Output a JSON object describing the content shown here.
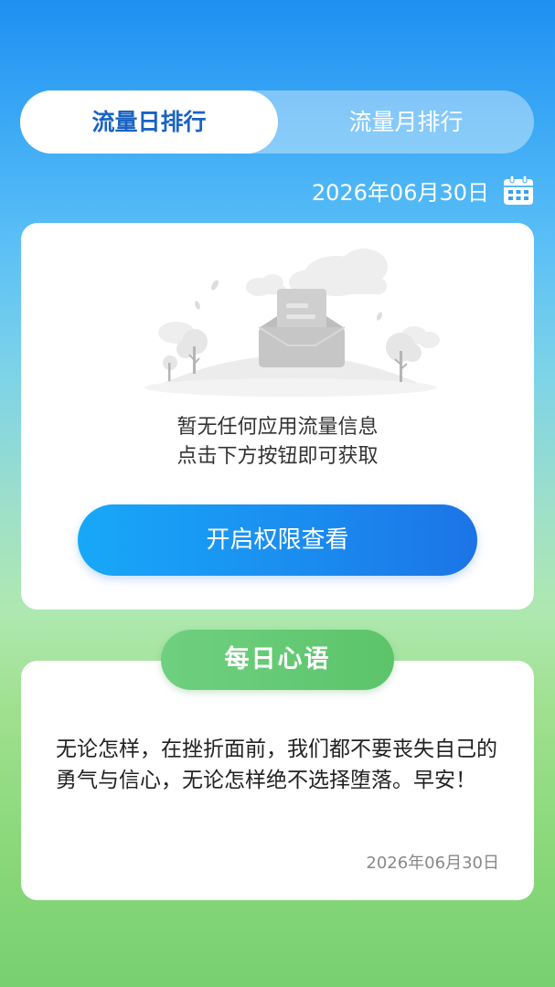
{
  "tabs": {
    "daily_label": "流量日排行",
    "monthly_label": "流量月排行"
  },
  "date_display": "2026年06月30日",
  "empty_state": {
    "line1": "暂无任何应用流量信息",
    "line2": "点击下方按钮即可获取",
    "button_label": "开启权限查看"
  },
  "daily_quote": {
    "title": "每日心语",
    "text": "无论怎样，在挫折面前，我们都不要丧失自己的勇气与信心，无论怎样绝不选择堕落。早安！",
    "date": "2026年06月30日"
  },
  "icons": {
    "calendar": "calendar-icon"
  },
  "colors": {
    "active_tab_text": "#1a63c4",
    "button_gradient_start": "#18a8f8",
    "button_gradient_end": "#1c74e6",
    "quote_pill": "#5cc46a"
  }
}
